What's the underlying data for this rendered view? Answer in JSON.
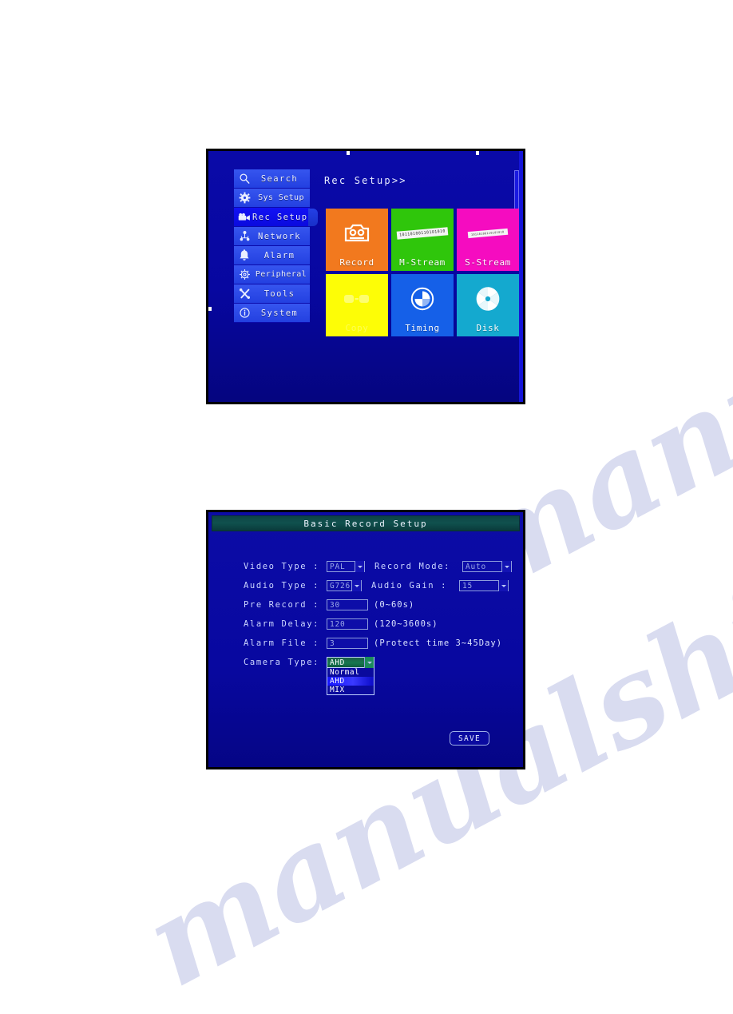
{
  "page": {
    "background": "#ffffff",
    "watermark_text": "manualshive.com"
  },
  "panel_rec_setup": {
    "header": "Rec Setup>>",
    "sidebar": {
      "items": [
        {
          "label": "Search",
          "icon": "search-icon",
          "active": false
        },
        {
          "label": "Sys Setup",
          "icon": "gear-icon",
          "active": false
        },
        {
          "label": "Rec Setup",
          "icon": "video-camera-icon",
          "active": true
        },
        {
          "label": "Network",
          "icon": "network-icon",
          "active": false
        },
        {
          "label": "Alarm",
          "icon": "bell-icon",
          "active": false
        },
        {
          "label": "Peripheral",
          "icon": "peripheral-icon",
          "active": false
        },
        {
          "label": "Tools",
          "icon": "tools-icon",
          "active": false
        },
        {
          "label": "System",
          "icon": "info-icon",
          "active": false
        }
      ]
    },
    "tiles": [
      {
        "label": "Record",
        "icon": "recorder-icon",
        "color": "#f2791e"
      },
      {
        "label": "M-Stream",
        "icon": "document-icon",
        "color": "#2fc60b"
      },
      {
        "label": "S-Stream",
        "icon": "document-icon",
        "color": "#f50cc0"
      },
      {
        "label": "Copy",
        "icon": "copy-icon",
        "color": "#fdfd06"
      },
      {
        "label": "Timing",
        "icon": "clock-icon",
        "color": "#1560e8"
      },
      {
        "label": "Disk",
        "icon": "disk-icon",
        "color": "#14a9cf"
      }
    ],
    "tile_strip_text": "10110100110101010"
  },
  "panel_basic_record": {
    "title": "Basic Record Setup",
    "fields": {
      "video_type_label": "Video Type :",
      "video_type_value": "PAL",
      "record_mode_label": "Record Mode:",
      "record_mode_value": "Auto",
      "audio_type_label": "Audio Type :",
      "audio_type_value": "G726",
      "audio_gain_label": "Audio Gain :",
      "audio_gain_value": "15",
      "pre_record_label": "Pre Record :",
      "pre_record_value": "30",
      "pre_record_hint": "(0~60s)",
      "alarm_delay_label": "Alarm Delay:",
      "alarm_delay_value": "120",
      "alarm_delay_hint": "(120~3600s)",
      "alarm_file_label": "Alarm File :",
      "alarm_file_value": "3",
      "alarm_file_hint": "(Protect time 3~45Day)",
      "camera_type_label": "Camera Type:",
      "camera_type_value": "AHD"
    },
    "camera_type_options": [
      {
        "label": "Normal",
        "selected": false
      },
      {
        "label": "AHD",
        "selected": true
      },
      {
        "label": "MIX",
        "selected": false
      }
    ],
    "save_label": "SAVE"
  }
}
